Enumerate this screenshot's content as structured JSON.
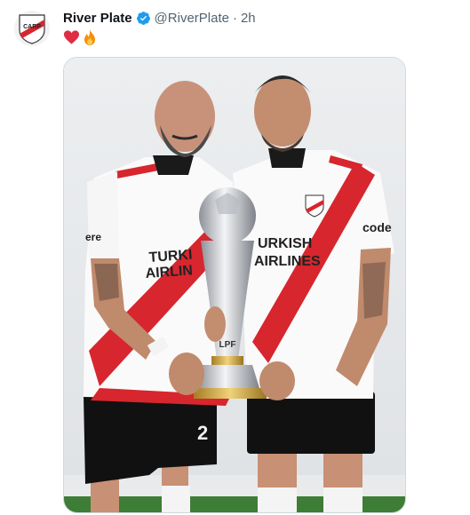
{
  "tweet": {
    "author_name": "River Plate",
    "handle": "@RiverPlate",
    "separator": "·",
    "time": "2h",
    "emojis": [
      "heart-emoji",
      "fire-emoji"
    ],
    "media": {
      "shirt_sponsor": "TURKISH AIRLINES",
      "trophy_text": "LPF",
      "left_number": "2"
    }
  },
  "colors": {
    "river_red": "#d7262e",
    "verified_blue": "#1d9bf0",
    "muted": "#536471"
  }
}
